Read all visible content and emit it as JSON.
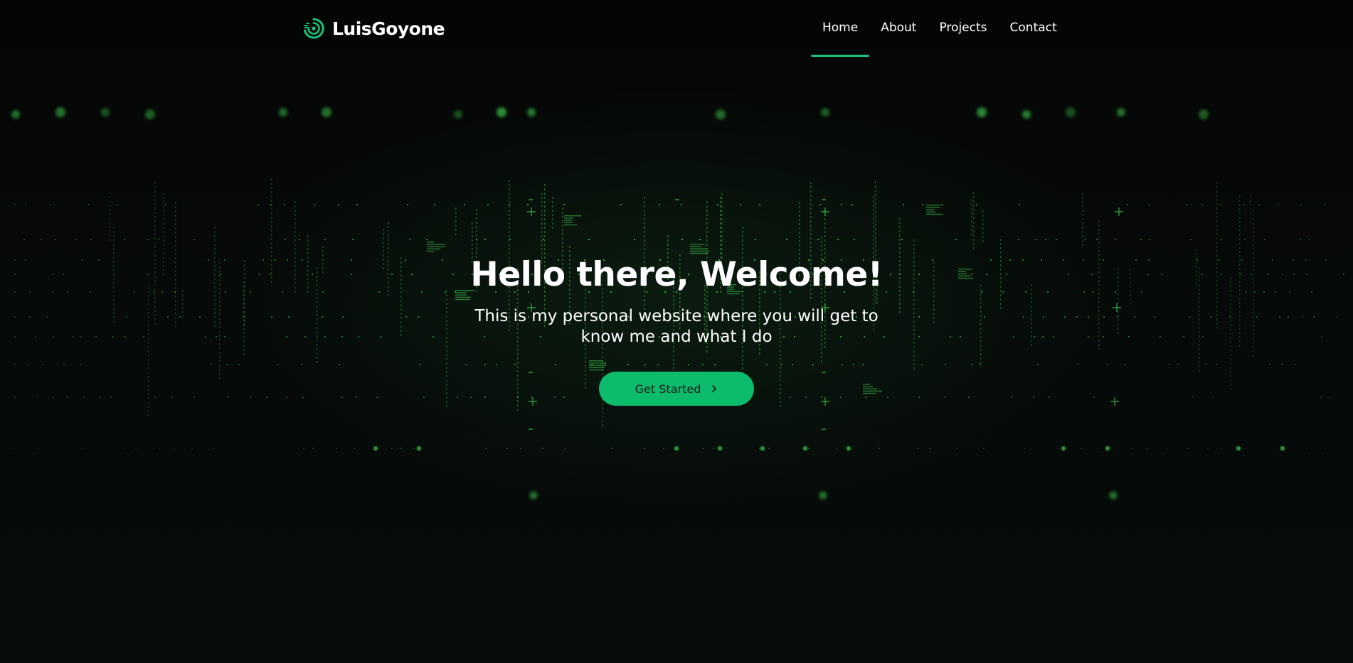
{
  "brand": {
    "name": "LuisGoyone",
    "logo_icon": "spiral-logo-icon",
    "accent_color": "#19c27a"
  },
  "nav": {
    "items": [
      {
        "label": "Home",
        "active": true
      },
      {
        "label": "About",
        "active": false
      },
      {
        "label": "Projects",
        "active": false
      },
      {
        "label": "Contact",
        "active": false
      }
    ]
  },
  "hero": {
    "title": "Hello there, Welcome!",
    "subtitle": "This is my personal website where you will get to know me and what I do",
    "cta_label": "Get Started",
    "cta_icon": "chevron-right-icon",
    "cta_color": "#0cbb6b"
  },
  "background": {
    "style": "matrix-code-grid",
    "dot_color": "#3cc34a"
  }
}
